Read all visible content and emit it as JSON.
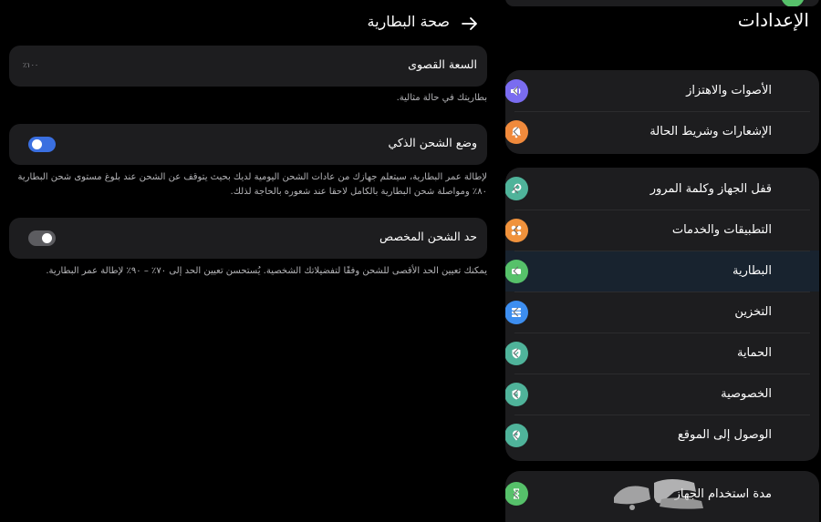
{
  "settings": {
    "title": "الإعدادات",
    "groups": [
      {
        "items": [
          {
            "label": "الأصوات والاهتزاز",
            "icon": "volume-icon",
            "color": "#7a6cf0"
          },
          {
            "label": "الإشعارات وشريط الحالة",
            "icon": "bell-icon",
            "color": "#f08a3c"
          }
        ]
      },
      {
        "items": [
          {
            "label": "قفل الجهاز وكلمة المرور",
            "icon": "key-icon",
            "color": "#4fb39a"
          },
          {
            "label": "التطبيقات والخدمات",
            "icon": "apps-icon",
            "color": "#f0923c"
          },
          {
            "label": "البطارية",
            "icon": "battery-icon",
            "color": "#56c16a",
            "selected": true
          },
          {
            "label": "التخزين",
            "icon": "storage-icon",
            "color": "#3d8ef0"
          },
          {
            "label": "الحماية",
            "icon": "shield-check-icon",
            "color": "#4fb39a"
          },
          {
            "label": "الخصوصية",
            "icon": "shield-lock-icon",
            "color": "#4fb39a"
          },
          {
            "label": "الوصول إلى الموقع",
            "icon": "location-pin-icon",
            "color": "#4fb39a"
          }
        ]
      },
      {
        "items": [
          {
            "label": "مدة استخدام الجهاز",
            "icon": "hourglass-icon",
            "color": "#56c16a"
          }
        ]
      }
    ]
  },
  "battery_health": {
    "title": "صحة البطارية",
    "max_capacity": {
      "label": "السعة القصوى",
      "value": "١٠٠٪"
    },
    "max_capacity_note": "بطاريتك في حالة مثالية.",
    "smart_charging": {
      "label": "وضع الشحن الذكي",
      "enabled": true
    },
    "smart_charging_note": "لإطالة عمر البطارية، سيتعلم جهازك من عادات الشحن اليومية لديك بحيث يتوقف عن الشحن عند بلوغ مستوى شحن البطارية ٨٠٪ ومواصلة شحن البطارية بالكامل لاحقا عند شعوره بالحاجة لذلك.",
    "custom_limit": {
      "label": "حد الشحن المخصص",
      "enabled": false
    },
    "custom_limit_note": "يمكنك تعيين الحد الأقصى للشحن وفقًا لتفضيلاتك الشخصية. يُستحسن تعيين الحد إلى ٧٠٪ – ٩٠٪ لإطالة عمر البطارية."
  },
  "colors": {
    "toggle_on": "#3a6fe0",
    "toggle_off": "#5c5c60"
  }
}
